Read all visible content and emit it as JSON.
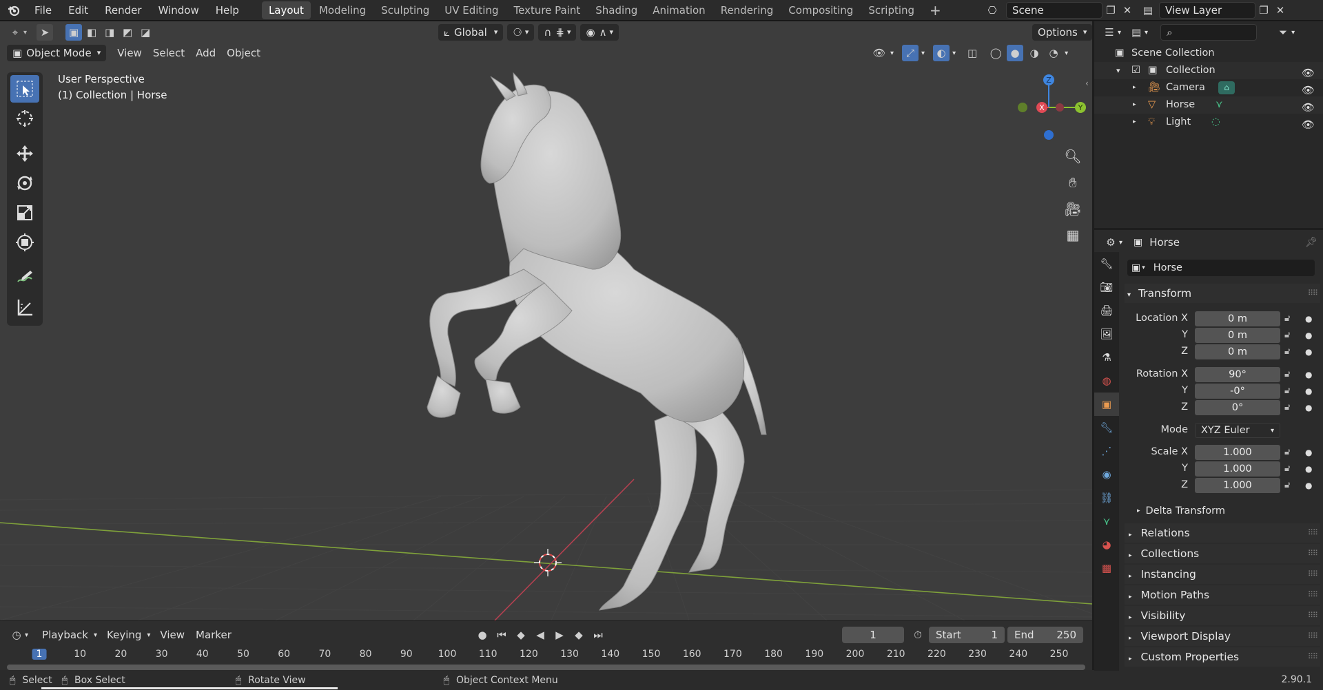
{
  "topbar": {
    "menus": [
      "File",
      "Edit",
      "Render",
      "Window",
      "Help"
    ],
    "workspaces": [
      "Layout",
      "Modeling",
      "Sculpting",
      "UV Editing",
      "Texture Paint",
      "Shading",
      "Animation",
      "Rendering",
      "Compositing",
      "Scripting"
    ],
    "active_workspace": "Layout",
    "add_tab": "+",
    "scene": "Scene",
    "view_layer": "View Layer"
  },
  "viewport": {
    "transform_orientation": "Global",
    "options_label": "Options",
    "mode": "Object Mode",
    "menus": [
      "View",
      "Select",
      "Add",
      "Object"
    ],
    "overlay_line1": "User Perspective",
    "overlay_line2": "(1) Collection | Horse",
    "gizmo_axes": {
      "x": "X",
      "y": "Y",
      "z": "Z"
    },
    "colors": {
      "background": "#3d3d3d",
      "x_axis": "#e04a55",
      "y_axis": "#8cc230",
      "z_axis": "#3f86e0",
      "active_tool": "#4772b3",
      "mesh": "#c9c9c9"
    }
  },
  "timeline": {
    "menus": [
      "Playback",
      "Keying",
      "View",
      "Marker"
    ],
    "current_frame": "1",
    "start_label": "Start",
    "start": "1",
    "end_label": "End",
    "end": "250",
    "ruler": [
      "1",
      "10",
      "20",
      "30",
      "40",
      "50",
      "60",
      "70",
      "80",
      "90",
      "100",
      "110",
      "120",
      "130",
      "140",
      "150",
      "160",
      "170",
      "180",
      "190",
      "200",
      "210",
      "220",
      "230",
      "240",
      "250"
    ]
  },
  "statusbar": {
    "select": "Select",
    "box_select": "Box Select",
    "rotate_view": "Rotate View",
    "context_menu": "Object Context Menu",
    "version": "2.90.1"
  },
  "outliner": {
    "root": "Scene Collection",
    "collection": "Collection",
    "items": [
      "Camera",
      "Horse",
      "Light"
    ]
  },
  "properties": {
    "header_object": "Horse",
    "object_name": "Horse",
    "transform_title": "Transform",
    "location_label": "Location X",
    "rotation_label": "Rotation X",
    "scale_label": "Scale X",
    "y_label": "Y",
    "z_label": "Z",
    "location": [
      "0 m",
      "0 m",
      "0 m"
    ],
    "rotation": [
      "90°",
      "-0°",
      "0°"
    ],
    "mode_label": "Mode",
    "mode_value": "XYZ Euler",
    "scale": [
      "1.000",
      "1.000",
      "1.000"
    ],
    "delta_transform": "Delta Transform",
    "panels": [
      "Relations",
      "Collections",
      "Instancing",
      "Motion Paths",
      "Visibility",
      "Viewport Display",
      "Custom Properties"
    ]
  }
}
